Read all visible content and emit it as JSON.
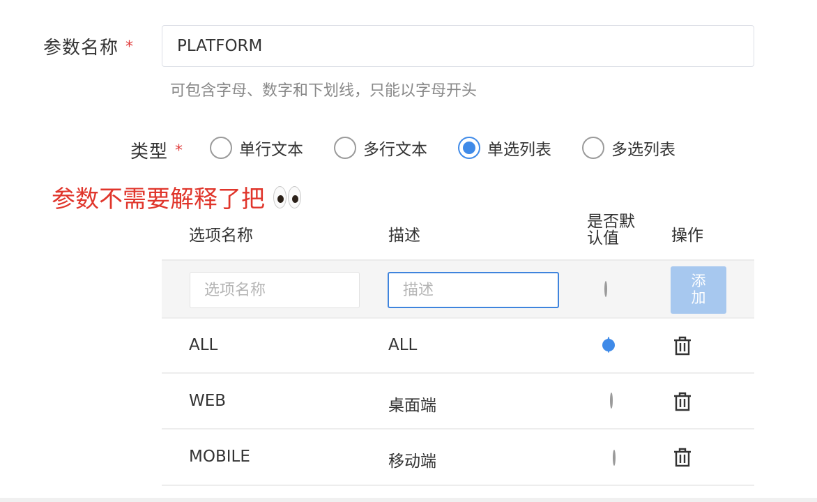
{
  "name_field": {
    "label": "参数名称",
    "required_mark": "*",
    "value": "PLATFORM",
    "help_text": "可包含字母、数字和下划线，只能以字母开头"
  },
  "type_field": {
    "label": "类型",
    "required_mark": "*",
    "options": [
      {
        "label": "单行文本",
        "checked": false
      },
      {
        "label": "多行文本",
        "checked": false
      },
      {
        "label": "单选列表",
        "checked": true
      },
      {
        "label": "多选列表",
        "checked": false
      }
    ]
  },
  "annotation": {
    "text": "参数不需要解释了把",
    "emoji": "eyes-emoji"
  },
  "options_table": {
    "headers": {
      "name": "选项名称",
      "description": "描述",
      "default_line1": "是否默",
      "default_line2": "认值",
      "actions": "操作"
    },
    "new_row": {
      "name_placeholder": "选项名称",
      "description_placeholder": "描述",
      "add_label_line1": "添",
      "add_label_line2": "加"
    },
    "rows": [
      {
        "name": "ALL",
        "description": "ALL",
        "is_default": true
      },
      {
        "name": "WEB",
        "description": "桌面端",
        "is_default": false
      },
      {
        "name": "MOBILE",
        "description": "移动端",
        "is_default": false
      }
    ]
  },
  "colors": {
    "accent": "#3f8ae8",
    "required": "#e03c3c",
    "annotation": "#e0352b",
    "add_button_disabled": "#a7c8ef"
  }
}
